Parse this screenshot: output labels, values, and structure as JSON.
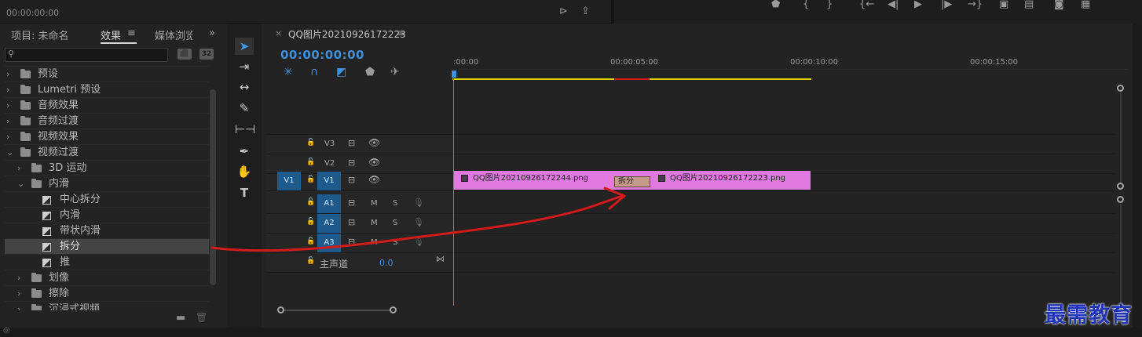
{
  "top": {
    "timecode": "00:00:00:00",
    "program_controls": [
      "marker-icon",
      "in-point-icon",
      "out-point-icon",
      "go-to-in-icon",
      "step-back-icon",
      "play-icon",
      "step-forward-icon",
      "go-to-out-icon",
      "lift-icon",
      "extract-icon",
      "export-frame-icon",
      "button-editor-icon"
    ]
  },
  "left_panel": {
    "tabs": [
      "项目: 未命名",
      "效果",
      "媒体浏览"
    ],
    "menu_glyph": "≡",
    "overflow_glyph": "»",
    "search_placeholder": "",
    "chips": [
      "⬛",
      "32"
    ],
    "tree": [
      {
        "label": "预设",
        "level": 0,
        "expanded": false,
        "kind": "folder-star"
      },
      {
        "label": "Lumetri 预设",
        "level": 0,
        "expanded": false,
        "kind": "folder-star"
      },
      {
        "label": "音频效果",
        "level": 0,
        "expanded": false,
        "kind": "folder"
      },
      {
        "label": "音频过渡",
        "level": 0,
        "expanded": false,
        "kind": "folder"
      },
      {
        "label": "视频效果",
        "level": 0,
        "expanded": false,
        "kind": "folder"
      },
      {
        "label": "视频过渡",
        "level": 0,
        "expanded": true,
        "kind": "folder"
      },
      {
        "label": "3D 运动",
        "level": 1,
        "expanded": false,
        "kind": "folder"
      },
      {
        "label": "内滑",
        "level": 1,
        "expanded": true,
        "kind": "folder"
      },
      {
        "label": "中心拆分",
        "level": 2,
        "kind": "effect"
      },
      {
        "label": "内滑",
        "level": 2,
        "kind": "effect"
      },
      {
        "label": "带状内滑",
        "level": 2,
        "kind": "effect"
      },
      {
        "label": "拆分",
        "level": 2,
        "kind": "effect",
        "selected": true
      },
      {
        "label": "推",
        "level": 2,
        "kind": "effect"
      },
      {
        "label": "划像",
        "level": 1,
        "expanded": false,
        "kind": "folder"
      },
      {
        "label": "擦除",
        "level": 1,
        "expanded": false,
        "kind": "folder"
      },
      {
        "label": "沉浸式视频",
        "level": 1,
        "expanded": false,
        "kind": "folder"
      }
    ]
  },
  "tools": [
    "selection-tool",
    "track-select-tool",
    "ripple-edit-tool",
    "razor-tool",
    "slip-tool",
    "pen-tool",
    "hand-tool",
    "type-tool"
  ],
  "sequence": {
    "close_glyph": "×",
    "title": "QQ图片20210926172223",
    "menu_glyph": "≡",
    "timecode": "00:00:00:00",
    "ruler_labels": [
      ":00:00",
      "00:00:05:00",
      "00:00:10:00",
      "00:00:15:00"
    ],
    "video_tracks": [
      {
        "name": "V3",
        "source": ""
      },
      {
        "name": "V2",
        "source": ""
      },
      {
        "name": "V1",
        "source": "V1"
      }
    ],
    "audio_tracks": [
      {
        "name": "A1",
        "m": "M",
        "s": "S"
      },
      {
        "name": "A2",
        "m": "M",
        "s": "S"
      },
      {
        "name": "A3",
        "m": "M",
        "s": "S"
      }
    ],
    "master": {
      "label": "主声道",
      "value": "0.0"
    },
    "clips": [
      {
        "name": "QQ图片20210926172244.png",
        "color": "#e07ae0"
      },
      {
        "name": "QQ图片20210926172223.png",
        "color": "#e07ae0"
      }
    ],
    "transition_label": "拆分"
  },
  "annotation_arrow_color": "#d41a1a",
  "watermark": "最需教育"
}
